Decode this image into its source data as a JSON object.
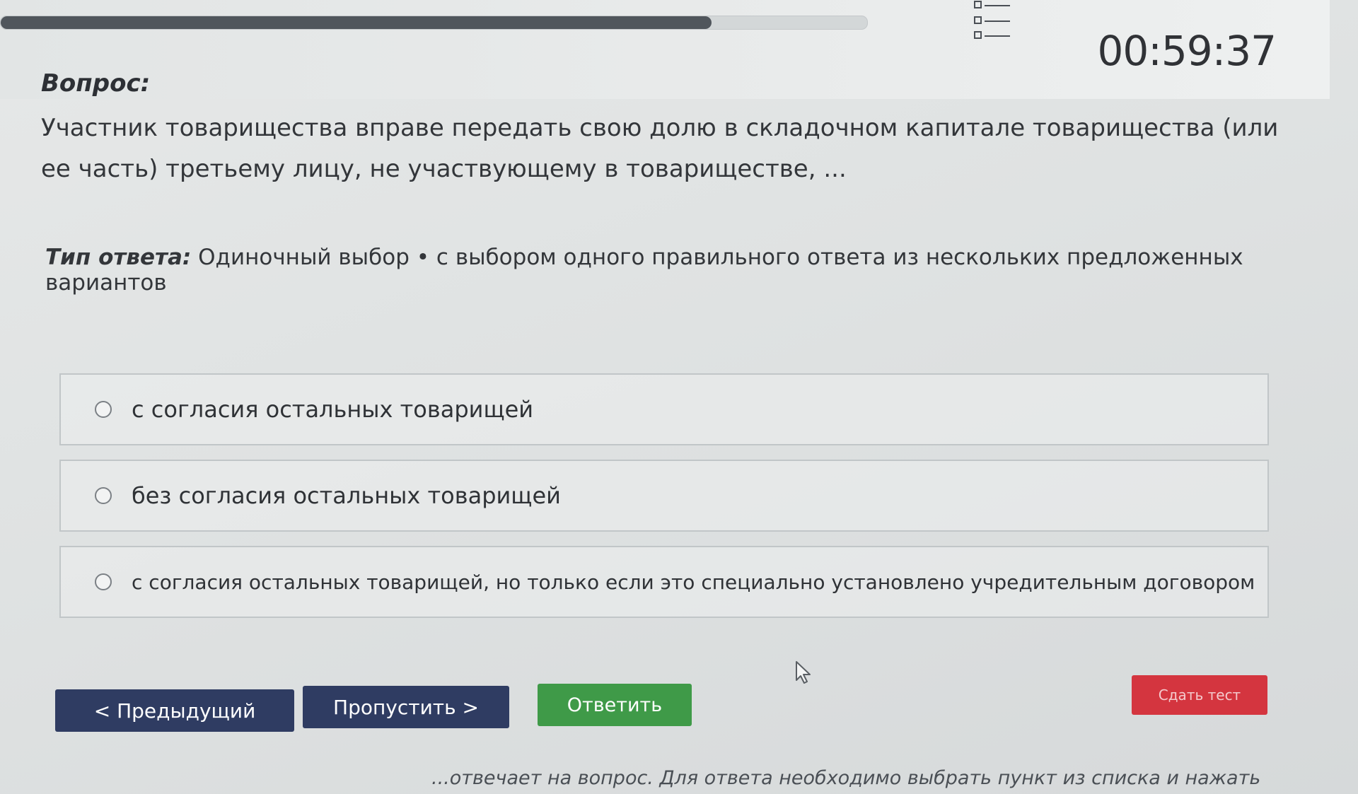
{
  "header": {
    "progress_fraction": 0.82,
    "timer": "00:59:37"
  },
  "question": {
    "label": "Вопрос:",
    "text": "Участник товарищества вправе передать свою долю в складочном капитале товарищества (или ее часть) третьему лицу, не участвующему в товариществе, ..."
  },
  "answer_type": {
    "label": "Тип ответа:",
    "value": "Одиночный выбор • с выбором одного правильного ответа из нескольких предложенных вариантов"
  },
  "options": [
    {
      "label": "с согласия остальных товарищей"
    },
    {
      "label": "без согласия остальных товарищей"
    },
    {
      "label": "с согласия остальных товарищей, но только если это специально установлено учредительным договором"
    }
  ],
  "buttons": {
    "prev": "< Предыдущий",
    "skip": "Пропустить >",
    "answer": "Ответить",
    "finish": "Сдать тест"
  },
  "hint": "...отвечает на вопрос. Для ответа необходимо выбрать пункт из списка и нажать",
  "icons": {
    "question_list": "list-icon",
    "cursor": "mouse-pointer-icon"
  },
  "colors": {
    "nav_button": "#2f3c62",
    "answer_button": "#3f9a48",
    "finish_button": "#d4353f"
  }
}
